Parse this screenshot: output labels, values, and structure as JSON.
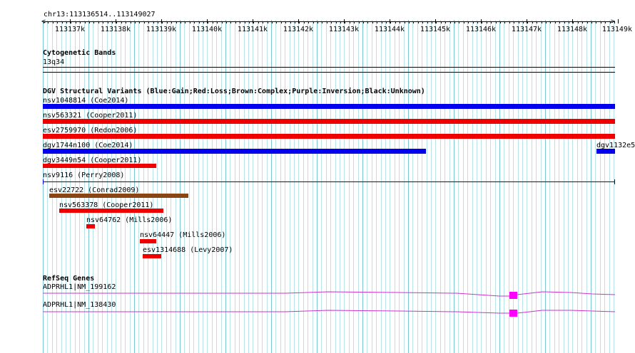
{
  "ruler": {
    "location": "chr13:113136514..113149027",
    "ticks": [
      "113137k",
      "113138k",
      "113139k",
      "113140k",
      "113141k",
      "113142k",
      "113143k",
      "113144k",
      "113145k",
      "113146k",
      "113147k",
      "113148k",
      "113149k"
    ]
  },
  "cytobands": {
    "title": "Cytogenetic Bands",
    "band": "13q34"
  },
  "dgv": {
    "title": "DGV Structural Variants (Blue:Gain;Red:Loss;Brown:Complex;Purple:Inversion;Black:Unknown)",
    "colors": {
      "gain": "#0000ee",
      "loss": "#ee0000",
      "complex": "#8b4513",
      "unknown_line": "#0000ee"
    },
    "variants": [
      {
        "label": "nsv1048814 (Coe2014)",
        "type": "gain"
      },
      {
        "label": "nsv563321 (Cooper2011)",
        "type": "loss"
      },
      {
        "label": "esv2759970 (Redon2006)",
        "type": "loss"
      },
      {
        "label": "dgv1744n100 (Coe2014)",
        "type": "gain"
      },
      {
        "label": "dgv1132e5",
        "type": "gain"
      },
      {
        "label": "dgv3449n54 (Cooper2011)",
        "type": "loss"
      },
      {
        "label": "nsv9116 (Perry2008)",
        "type": "gain"
      },
      {
        "label": "esv22722 (Conrad2009)",
        "type": "complex"
      },
      {
        "label": "nsv563378 (Cooper2011)",
        "type": "loss"
      },
      {
        "label": "nsv64762 (Mills2006)",
        "type": "loss"
      },
      {
        "label": "nsv64447 (Mills2006)",
        "type": "loss"
      },
      {
        "label": "esv1314688 (Levy2007)",
        "type": "loss"
      }
    ]
  },
  "refseq": {
    "title": "RefSeq Genes",
    "line_color": "#cc33cc",
    "exon_color": "#ff00ff",
    "genes": [
      {
        "label": "ADPRHL1|NM_199162"
      },
      {
        "label": "ADPRHL1|NM_138430"
      }
    ]
  }
}
